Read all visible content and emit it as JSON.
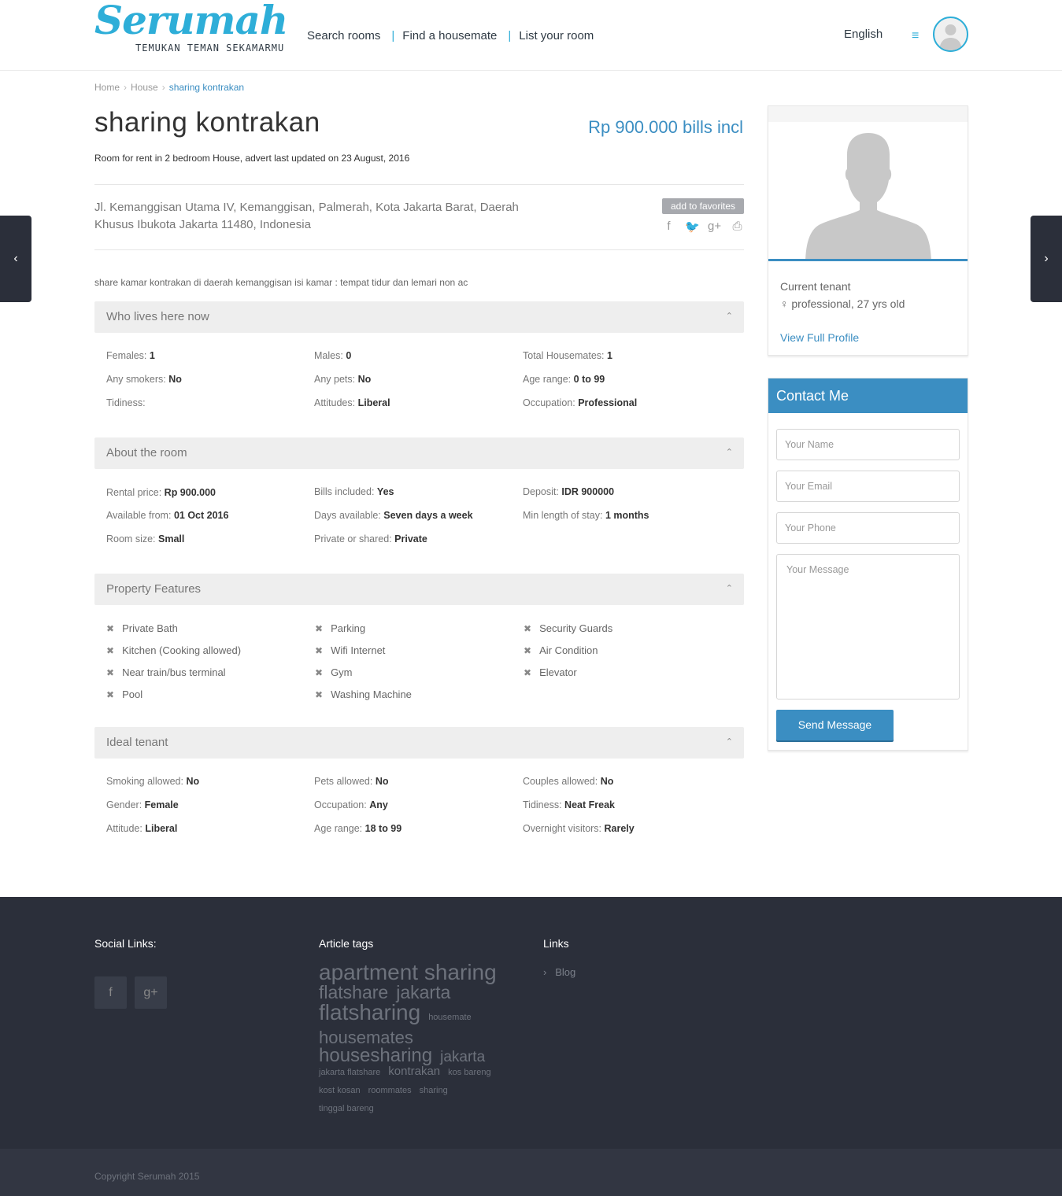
{
  "header": {
    "logo_text": "Serumah",
    "logo_tagline": "TEMUKAN TEMAN SEKAMARMU",
    "nav": [
      "Search rooms",
      "Find a housemate",
      "List your room"
    ],
    "language": "English"
  },
  "breadcrumb": [
    "Home",
    "House",
    "sharing kontrakan"
  ],
  "listing": {
    "title": "sharing kontrakan",
    "price": "Rp 900.000 bills incl",
    "subtitle": "Room for rent in 2 bedroom House, advert last updated on 23 August, 2016",
    "address": "Jl. Kemanggisan Utama IV, Kemanggisan, Palmerah, Kota Jakarta Barat, Daerah Khusus Ibukota Jakarta 11480, Indonesia",
    "favorites_label": "add to favorites",
    "description": "share kamar kontrakan di daerah kemanggisan isi kamar : tempat tidur dan lemari non ac"
  },
  "who_lives": {
    "title": "Who lives here now",
    "rows": [
      [
        {
          "label": "Females:",
          "value": "1"
        },
        {
          "label": "Males:",
          "value": "0"
        },
        {
          "label": "Total Housemates:",
          "value": "1"
        }
      ],
      [
        {
          "label": "Any smokers:",
          "value": "No"
        },
        {
          "label": "Any pets:",
          "value": "No"
        },
        {
          "label": "Age range:",
          "value": "0 to 99"
        }
      ],
      [
        {
          "label": "Tidiness:",
          "value": ""
        },
        {
          "label": "Attitudes:",
          "value": "Liberal"
        },
        {
          "label": "Occupation:",
          "value": "Professional"
        }
      ]
    ]
  },
  "about_room": {
    "title": "About the room",
    "rows": [
      [
        {
          "label": "Rental price:",
          "value": "Rp 900.000"
        },
        {
          "label": "Bills included:",
          "value": "Yes"
        },
        {
          "label": "Deposit:",
          "value": "IDR 900000"
        }
      ],
      [
        {
          "label": "Available from:",
          "value": "01 Oct 2016"
        },
        {
          "label": "Days available:",
          "value": "Seven days a week"
        },
        {
          "label": "Min length of stay:",
          "value": "1 months"
        }
      ],
      [
        {
          "label": "Room size:",
          "value": "Small"
        },
        {
          "label": "Private or shared:",
          "value": "Private"
        },
        {
          "label": "",
          "value": ""
        }
      ]
    ]
  },
  "features": {
    "title": "Property Features",
    "rows": [
      [
        "Private Bath",
        "Parking",
        "Security Guards"
      ],
      [
        "Kitchen (Cooking allowed)",
        "Wifi Internet",
        "Air Condition"
      ],
      [
        "Near train/bus terminal",
        "Gym",
        "Elevator"
      ],
      [
        "Pool",
        "Washing Machine",
        ""
      ]
    ]
  },
  "ideal_tenant": {
    "title": "Ideal tenant",
    "rows": [
      [
        {
          "label": "Smoking allowed:",
          "value": "No"
        },
        {
          "label": "Pets allowed:",
          "value": "No"
        },
        {
          "label": "Couples allowed:",
          "value": "No"
        }
      ],
      [
        {
          "label": "Gender:",
          "value": "Female"
        },
        {
          "label": "Occupation:",
          "value": "Any"
        },
        {
          "label": "Tidiness:",
          "value": "Neat Freak"
        }
      ],
      [
        {
          "label": "Attitude:",
          "value": "Liberal"
        },
        {
          "label": "Age range:",
          "value": "18 to 99"
        },
        {
          "label": "Overnight visitors:",
          "value": "Rarely"
        }
      ]
    ]
  },
  "tenant": {
    "label": "Current tenant",
    "info": "professional, 27 yrs old",
    "link": "View Full Profile"
  },
  "contact": {
    "title": "Contact Me",
    "name_placeholder": "Your Name",
    "email_placeholder": "Your Email",
    "phone_placeholder": "Your Phone",
    "message_placeholder": "Your Message",
    "send_label": "Send Message"
  },
  "footer": {
    "social_title": "Social Links:",
    "tags_title": "Article tags",
    "links_title": "Links",
    "tags": [
      {
        "text": "apartment sharing",
        "size": 28
      },
      {
        "text": "flatshare",
        "size": 23
      },
      {
        "text": "jakarta",
        "size": 23
      },
      {
        "text": "flatsharing",
        "size": 28
      },
      {
        "text": "housemate",
        "size": 11
      },
      {
        "text": "housemates",
        "size": 22
      },
      {
        "text": "housesharing",
        "size": 24
      },
      {
        "text": "jakarta",
        "size": 19
      },
      {
        "text": "jakarta flatshare",
        "size": 11
      },
      {
        "text": "kontrakan",
        "size": 15
      },
      {
        "text": "kos bareng",
        "size": 11
      },
      {
        "text": "kost kosan",
        "size": 11
      },
      {
        "text": "roommates",
        "size": 11
      },
      {
        "text": "sharing",
        "size": 11
      },
      {
        "text": "tinggal bareng",
        "size": 11
      }
    ],
    "links": [
      "Blog"
    ],
    "copyright": "Copyright Serumah 2015"
  },
  "colors": {
    "accent": "#3b8ec2",
    "logo": "#2eaed8",
    "footer_bg": "#2b2f3a"
  }
}
